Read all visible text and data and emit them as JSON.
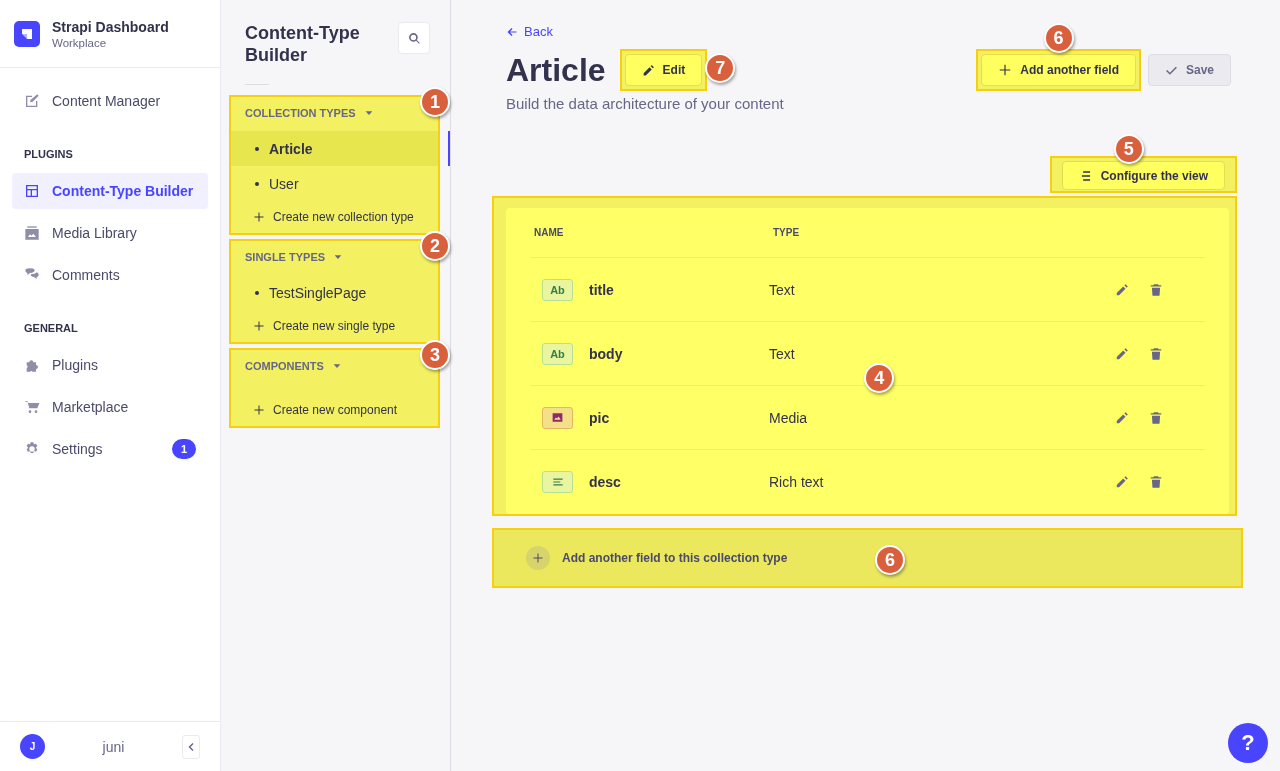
{
  "brand": {
    "title": "Strapi Dashboard",
    "subtitle": "Workplace"
  },
  "nav": [
    {
      "kind": "link",
      "label": "Content Manager",
      "selected": false
    },
    {
      "kind": "heading",
      "label": "PLUGINS"
    },
    {
      "kind": "link",
      "label": "Content-Type Builder",
      "selected": true
    },
    {
      "kind": "link",
      "label": "Media Library",
      "selected": false
    },
    {
      "kind": "link",
      "label": "Comments",
      "selected": false
    },
    {
      "kind": "heading",
      "label": "GENERAL"
    },
    {
      "kind": "link",
      "label": "Plugins",
      "selected": false
    },
    {
      "kind": "link",
      "label": "Marketplace",
      "selected": false
    },
    {
      "kind": "link",
      "label": "Settings",
      "selected": false,
      "badge": "1"
    }
  ],
  "user": {
    "initial": "J",
    "name": "juni"
  },
  "builder": {
    "title": "Content-Type Builder",
    "groups": [
      {
        "title": "COLLECTION TYPES",
        "marker": "1",
        "items": [
          {
            "label": "Article",
            "selected": true
          },
          {
            "label": "User",
            "selected": false
          }
        ],
        "create": "Create new collection type"
      },
      {
        "title": "SINGLE TYPES",
        "marker": "2",
        "items": [
          {
            "label": "TestSinglePage",
            "selected": false
          }
        ],
        "create": "Create new single type"
      },
      {
        "title": "COMPONENTS",
        "marker": "3",
        "create": "Create new component"
      }
    ]
  },
  "page": {
    "back": "Back",
    "title": "Article",
    "subtitle": "Build the data architecture of your content",
    "edit": {
      "label": "Edit",
      "marker": "7"
    },
    "add_field": {
      "label": "Add another field",
      "marker": "6"
    },
    "save": {
      "label": "Save",
      "disabled": true
    },
    "configure": {
      "label": "Configure the view",
      "marker": "5"
    },
    "table": {
      "marker": "4",
      "columns": [
        "NAME",
        "TYPE"
      ],
      "rows": [
        {
          "kind": "text",
          "badge": "Ab",
          "name": "title",
          "type": "Text"
        },
        {
          "kind": "text",
          "badge": "Ab",
          "name": "body",
          "type": "Text"
        },
        {
          "kind": "media",
          "name": "pic",
          "type": "Media"
        },
        {
          "kind": "richtext",
          "name": "desc",
          "type": "Rich text"
        }
      ]
    },
    "add_row": {
      "label": "Add another field to this collection type",
      "marker": "6"
    }
  },
  "help": "?"
}
